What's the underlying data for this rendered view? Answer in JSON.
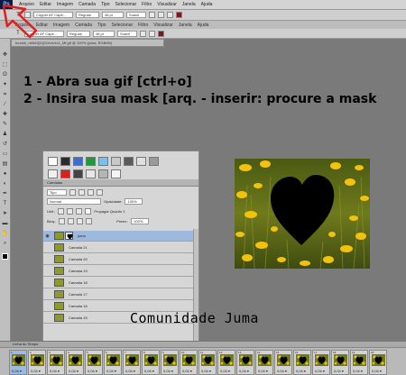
{
  "menubar": {
    "logo": "Ps",
    "items": [
      "Arquivo",
      "Editar",
      "Imagem",
      "Camada",
      "Tipo",
      "Selecionar",
      "Filtro",
      "Visualizar",
      "Janela",
      "Ajuda"
    ]
  },
  "options": {
    "font_family": "Copper AF Capit...",
    "font_style": "Regular",
    "size": "48 pt",
    "aa": "Suave"
  },
  "document_tab": "fundoh_nb6d3j11j01rtoivxc1_Mf.gif @ 100% (juma, RGB/8#)",
  "instructions": [
    "1 - Abra sua gif [ctrl+o]",
    "2 - Insira sua mask [arq. - inserir: procure a mask"
  ],
  "layers_panel": {
    "title": "Camadas",
    "filter": "Tipo",
    "blend_mode": "Normal",
    "opacity_label": "Opacidade:",
    "opacity": "100%",
    "unify_label": "Unif.:",
    "propagate_label": "Propagar Quadro 1",
    "lock_label": "Bloq.:",
    "fill_label": "Preen.:",
    "fill": "100%",
    "layers": [
      {
        "name": "juma",
        "selected": true
      },
      {
        "name": "Camada 21",
        "selected": false
      },
      {
        "name": "Camada 20",
        "selected": false
      },
      {
        "name": "Camada 19",
        "selected": false
      },
      {
        "name": "Camada 18",
        "selected": false
      },
      {
        "name": "Camada 17",
        "selected": false
      },
      {
        "name": "Camada 16",
        "selected": false
      },
      {
        "name": "Camada 15",
        "selected": false
      }
    ]
  },
  "watermark": "Comunidade Juma",
  "timeline": {
    "title": "Linha do Tempo",
    "frames": [
      {
        "num": "1",
        "delay": "0,04 ▾"
      },
      {
        "num": "2",
        "delay": "0,04 ▾"
      },
      {
        "num": "3",
        "delay": "0,04 ▾"
      },
      {
        "num": "4",
        "delay": "0,04 ▾"
      },
      {
        "num": "5",
        "delay": "0,04 ▾"
      },
      {
        "num": "6",
        "delay": "0,04 ▾"
      },
      {
        "num": "7",
        "delay": "0,04 ▾"
      },
      {
        "num": "8",
        "delay": "0,04 ▾"
      },
      {
        "num": "9",
        "delay": "0,04 ▾"
      },
      {
        "num": "10",
        "delay": "0,04 ▾"
      },
      {
        "num": "11",
        "delay": "0,04 ▾"
      },
      {
        "num": "12",
        "delay": "0,04 ▾"
      },
      {
        "num": "13",
        "delay": "0,04 ▾"
      },
      {
        "num": "14",
        "delay": "0,04 ▾"
      },
      {
        "num": "15",
        "delay": "0,04 ▾"
      },
      {
        "num": "16",
        "delay": "0,04 ▾"
      },
      {
        "num": "17",
        "delay": "0,04 ▾"
      },
      {
        "num": "18",
        "delay": "0,04 ▾"
      },
      {
        "num": "19",
        "delay": "0,04 ▾"
      },
      {
        "num": "20",
        "delay": "0,04 ▾"
      }
    ]
  },
  "colors": {
    "accent_arrow": "#e0201c",
    "selection": "#9fb8dd",
    "foreground": "#000000"
  }
}
